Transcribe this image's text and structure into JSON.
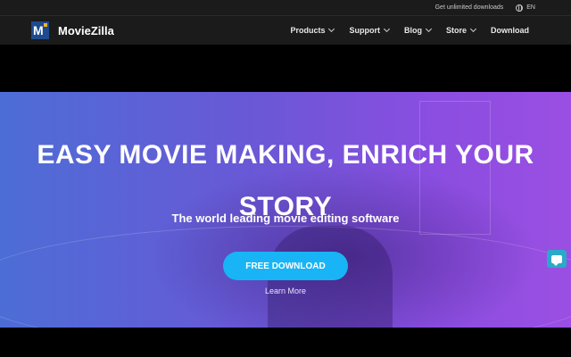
{
  "topbar": {
    "promo": "Get unlimited downloads",
    "lang": "EN"
  },
  "brand": {
    "name": "MovieZilla"
  },
  "nav": {
    "items": [
      {
        "label": "Products",
        "dropdown": true
      },
      {
        "label": "Support",
        "dropdown": true
      },
      {
        "label": "Blog",
        "dropdown": true
      },
      {
        "label": "Store",
        "dropdown": true
      },
      {
        "label": "Download",
        "dropdown": false
      }
    ]
  },
  "hero": {
    "headline_line1": "EASY MOVIE MAKING, ENRICH YOUR",
    "headline_line2": "STORY",
    "subline": "The world leading movie editing software",
    "cta": "FREE DOWNLOAD",
    "learn_more": "Learn More"
  },
  "colors": {
    "accent": "#19b4f5",
    "navbar": "#1b1b1b",
    "chat": "#2aa9c8"
  }
}
